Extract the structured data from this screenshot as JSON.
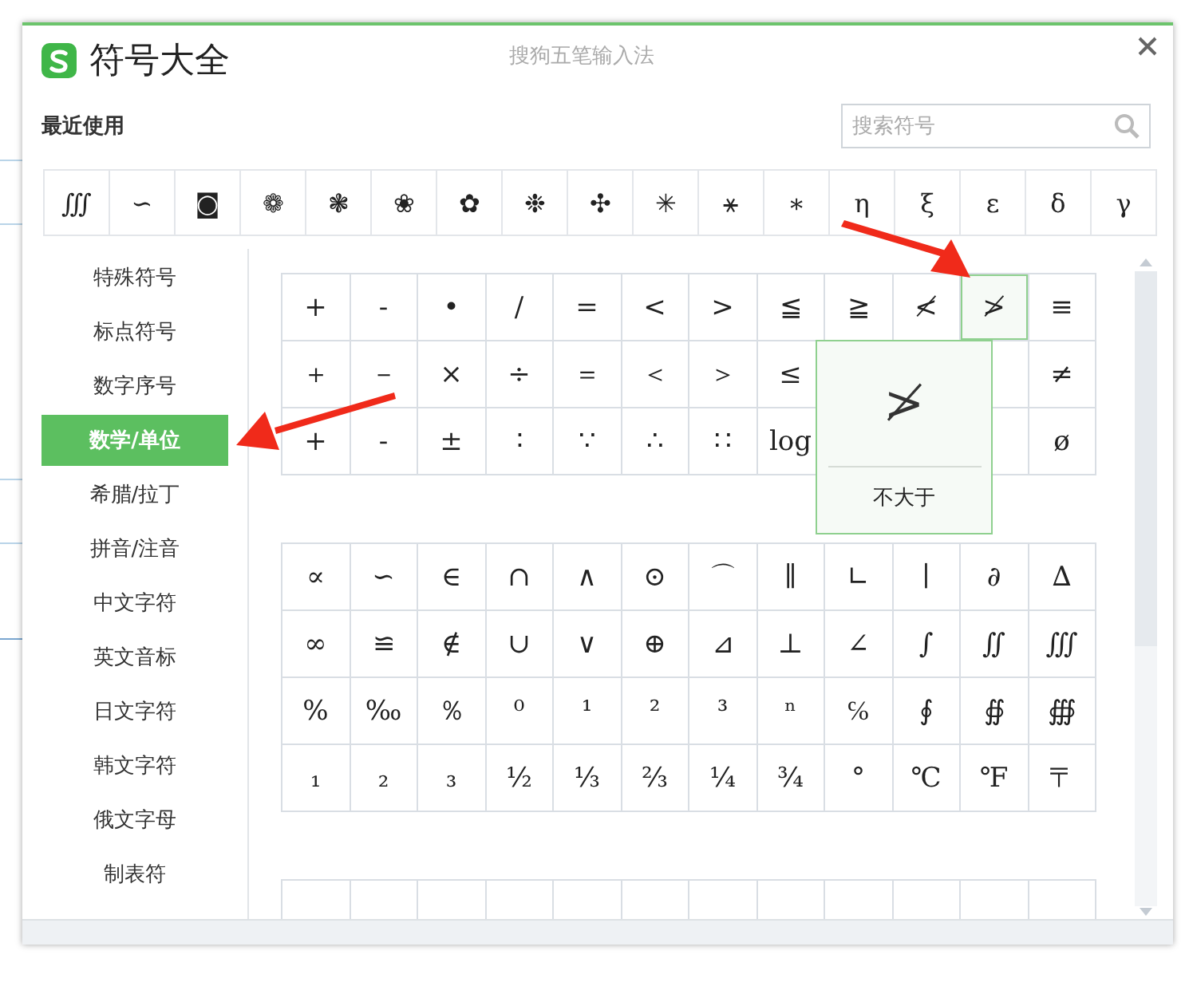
{
  "window": {
    "app_name": "符号大全",
    "title": "搜狗五笔输入法"
  },
  "recent": {
    "label": "最近使用",
    "symbols": [
      "∭",
      "∽",
      "◙",
      "❁",
      "❃",
      "❀",
      "✿",
      "❉",
      "✣",
      "✳",
      "⚹",
      "∗",
      "η",
      "ξ",
      "ε",
      "δ",
      "γ"
    ]
  },
  "search": {
    "placeholder": "搜索符号"
  },
  "categories": [
    {
      "label": "特殊符号",
      "selected": false
    },
    {
      "label": "标点符号",
      "selected": false
    },
    {
      "label": "数字序号",
      "selected": false
    },
    {
      "label": "数学/单位",
      "selected": true
    },
    {
      "label": "希腊/拉丁",
      "selected": false
    },
    {
      "label": "拼音/注音",
      "selected": false
    },
    {
      "label": "中文字符",
      "selected": false
    },
    {
      "label": "英文音标",
      "selected": false
    },
    {
      "label": "日文字符",
      "selected": false
    },
    {
      "label": "韩文字符",
      "selected": false
    },
    {
      "label": "俄文字母",
      "selected": false
    },
    {
      "label": "制表符",
      "selected": false
    }
  ],
  "groups": [
    {
      "rows": [
        [
          {
            "symbol": "+",
            "selected": false
          },
          {
            "symbol": "-",
            "selected": false
          },
          {
            "symbol": "•",
            "selected": false
          },
          {
            "symbol": "/",
            "selected": false
          },
          {
            "symbol": "=",
            "selected": false
          },
          {
            "symbol": "<",
            "selected": false
          },
          {
            "symbol": ">",
            "selected": false
          },
          {
            "symbol": "≦",
            "selected": false
          },
          {
            "symbol": "≧",
            "selected": false
          },
          {
            "symbol": "≮",
            "selected": false
          },
          {
            "symbol": "≯",
            "selected": true
          },
          {
            "symbol": "≡",
            "selected": false
          }
        ],
        [
          {
            "symbol": "＋",
            "selected": false
          },
          {
            "symbol": "－",
            "selected": false
          },
          {
            "symbol": "×",
            "selected": false
          },
          {
            "symbol": "÷",
            "selected": false
          },
          {
            "symbol": "＝",
            "selected": false
          },
          {
            "symbol": "＜",
            "selected": false
          },
          {
            "symbol": "＞",
            "selected": false
          },
          {
            "symbol": "≤",
            "selected": false
          },
          null,
          null,
          null,
          {
            "symbol": "≠",
            "selected": false
          }
        ],
        [
          {
            "symbol": "+",
            "selected": false
          },
          {
            "symbol": "-",
            "selected": false
          },
          {
            "symbol": "±",
            "selected": false
          },
          {
            "symbol": "∶",
            "selected": false
          },
          {
            "symbol": "∵",
            "selected": false
          },
          {
            "symbol": "∴",
            "selected": false
          },
          {
            "symbol": "∷",
            "selected": false
          },
          {
            "symbol": "log",
            "selected": false
          },
          null,
          null,
          null,
          {
            "symbol": "ø",
            "selected": false
          }
        ]
      ]
    },
    {
      "rows": [
        [
          {
            "symbol": "∝",
            "selected": false
          },
          {
            "symbol": "∽",
            "selected": false
          },
          {
            "symbol": "∈",
            "selected": false
          },
          {
            "symbol": "∩",
            "selected": false
          },
          {
            "symbol": "∧",
            "selected": false
          },
          {
            "symbol": "⊙",
            "selected": false
          },
          {
            "symbol": "⌒",
            "selected": false
          },
          {
            "symbol": "∥",
            "selected": false
          },
          {
            "symbol": "∟",
            "selected": false
          },
          {
            "symbol": "∣",
            "selected": false
          },
          {
            "symbol": "∂",
            "selected": false
          },
          {
            "symbol": "∆",
            "selected": false
          }
        ],
        [
          {
            "symbol": "∞",
            "selected": false
          },
          {
            "symbol": "≌",
            "selected": false
          },
          {
            "symbol": "∉",
            "selected": false
          },
          {
            "symbol": "∪",
            "selected": false
          },
          {
            "symbol": "∨",
            "selected": false
          },
          {
            "symbol": "⊕",
            "selected": false
          },
          {
            "symbol": "⊿",
            "selected": false
          },
          {
            "symbol": "⊥",
            "selected": false
          },
          {
            "symbol": "∠",
            "selected": false
          },
          {
            "symbol": "∫",
            "selected": false
          },
          {
            "symbol": "∬",
            "selected": false
          },
          {
            "symbol": "∭",
            "selected": false
          }
        ],
        [
          {
            "symbol": "%",
            "selected": false
          },
          {
            "symbol": "‰",
            "selected": false
          },
          {
            "symbol": "％",
            "selected": false
          },
          {
            "symbol": "⁰",
            "selected": false
          },
          {
            "symbol": "¹",
            "selected": false
          },
          {
            "symbol": "²",
            "selected": false
          },
          {
            "symbol": "³",
            "selected": false
          },
          {
            "symbol": "ⁿ",
            "selected": false
          },
          {
            "symbol": "℅",
            "selected": false
          },
          {
            "symbol": "∮",
            "selected": false
          },
          {
            "symbol": "∯",
            "selected": false
          },
          {
            "symbol": "∰",
            "selected": false
          }
        ],
        [
          {
            "symbol": "₁",
            "selected": false
          },
          {
            "symbol": "₂",
            "selected": false
          },
          {
            "symbol": "₃",
            "selected": false
          },
          {
            "symbol": "½",
            "selected": false
          },
          {
            "symbol": "⅓",
            "selected": false
          },
          {
            "symbol": "⅔",
            "selected": false
          },
          {
            "symbol": "¼",
            "selected": false
          },
          {
            "symbol": "¾",
            "selected": false
          },
          {
            "symbol": "°",
            "selected": false
          },
          {
            "symbol": "℃",
            "selected": false
          },
          {
            "symbol": "℉",
            "selected": false
          },
          {
            "symbol": "〒",
            "selected": false
          }
        ]
      ]
    },
    {
      "rows": [
        [
          null,
          null,
          null,
          null,
          null,
          null,
          null,
          null,
          null,
          null,
          null,
          null
        ]
      ]
    }
  ],
  "tooltip": {
    "symbol": "≯",
    "label": "不大于"
  }
}
